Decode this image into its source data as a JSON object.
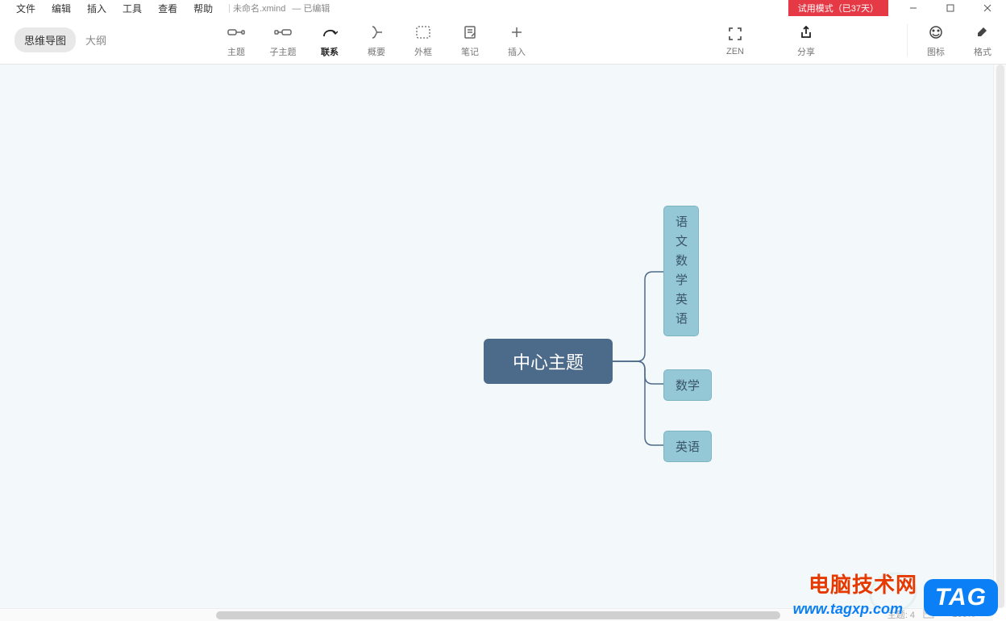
{
  "menu": {
    "items": [
      "文件",
      "编辑",
      "插入",
      "工具",
      "查看",
      "帮助"
    ]
  },
  "document": {
    "filename": "未命名.xmind",
    "status": "已编辑"
  },
  "trial": {
    "label": "试用模式（已37天）"
  },
  "viewTabs": {
    "mindmap": "思维导图",
    "outline": "大纲"
  },
  "tools": {
    "topic": "主题",
    "subtopic": "子主题",
    "relationship": "联系",
    "summary": "概要",
    "boundary": "外框",
    "notes": "笔记",
    "insert": "插入"
  },
  "rightTools": {
    "zen": "ZEN",
    "share": "分享",
    "icons": "图标",
    "format": "格式"
  },
  "mindmap": {
    "central": "中心主题",
    "node1_chars": [
      "语",
      "文",
      "数",
      "学",
      "英",
      "语"
    ],
    "node2": "数学",
    "node3": "英语"
  },
  "status": {
    "topicCount": "主题: 4",
    "zoom": "100%"
  },
  "watermark": {
    "site_name": "电脑技术网",
    "site_url": "www.tagxp.com",
    "tag": "TAG"
  }
}
